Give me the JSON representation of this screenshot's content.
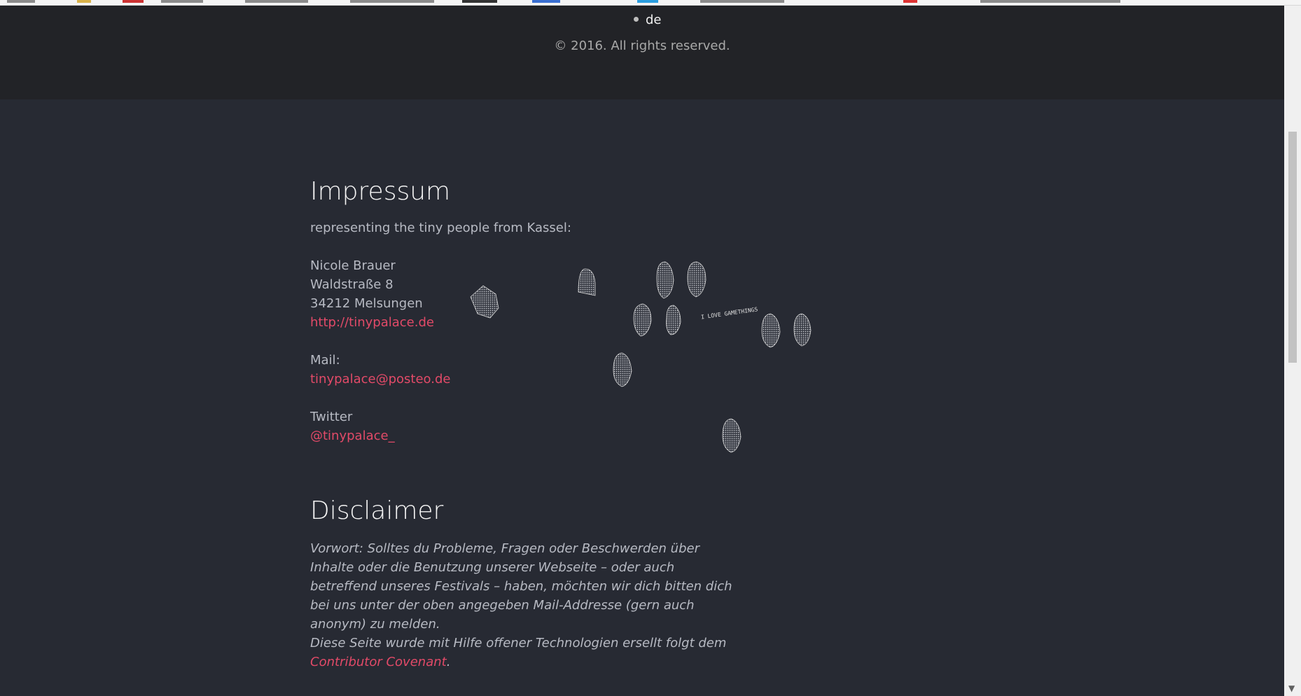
{
  "footer": {
    "language": "de",
    "copyright": "© 2016. All rights reserved."
  },
  "impressum": {
    "title": "Impressum",
    "intro": "representing the tiny people from Kassel:",
    "name": "Nicole Brauer",
    "street": "Waldstraße 8",
    "city": "34212 Melsungen",
    "website": "http://tinypalace.de",
    "mail_label": "Mail:",
    "mail": "tinypalace@posteo.de",
    "twitter_label": "Twitter",
    "twitter": "@tinypalace_"
  },
  "disclaimer": {
    "title": "Disclaimer",
    "paragraph1": "Vorwort: Solltes du Probleme, Fragen oder Beschwerden über Inhalte oder die Benutzung unserer Webseite – oder auch betreffend unseres Festivals – haben, möchten wir dich bitten dich bei uns unter der oben angegeben Mail-Addresse (gern auch anonym) zu melden.",
    "paragraph2_prefix": "Diese Seite wurde mit Hilfe offener Technologien ersellt folgt dem ",
    "paragraph2_link": "Contributor Covenant",
    "paragraph2_suffix": "."
  },
  "doodle_caption": "I LOVE GAMETHINGS",
  "colors": {
    "background": "#272a33",
    "footer_background": "#222327",
    "link": "#e24a68",
    "heading": "#f4f4f4",
    "body_text": "#b7bac3"
  }
}
